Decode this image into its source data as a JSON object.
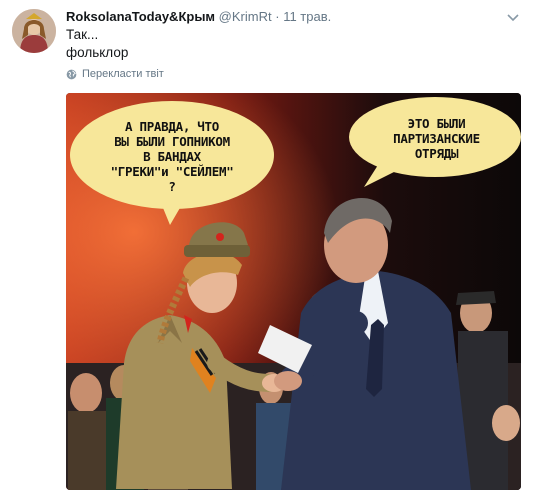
{
  "author": {
    "name": "RoksolanaToday&Крым",
    "handle": "@KrimRt",
    "separator": "·",
    "date": "11 трав."
  },
  "tweet": {
    "line1": "Так...",
    "line2": "фольклор"
  },
  "translate_label": "Перекласти твіт",
  "media": {
    "bubble_left_lines": [
      "А ПРАВДА, ЧТО",
      "ВЫ БЫЛИ ГОПНИКОМ",
      "В БАНДАХ",
      "\"ГРЕКИ\"и \"СЕЙЛЕМ\"",
      "?"
    ],
    "bubble_right_lines": [
      "ЭТО БЫЛИ",
      "ПАРТИЗАНСКИЕ",
      "ОТРЯДЫ"
    ]
  },
  "icons": {
    "globe": "globe-icon",
    "caret": "chevron-down-icon",
    "avatar": "avatar"
  },
  "colors": {
    "bubble": "#f7e79a",
    "text": "#14171a",
    "muted": "#657786"
  }
}
